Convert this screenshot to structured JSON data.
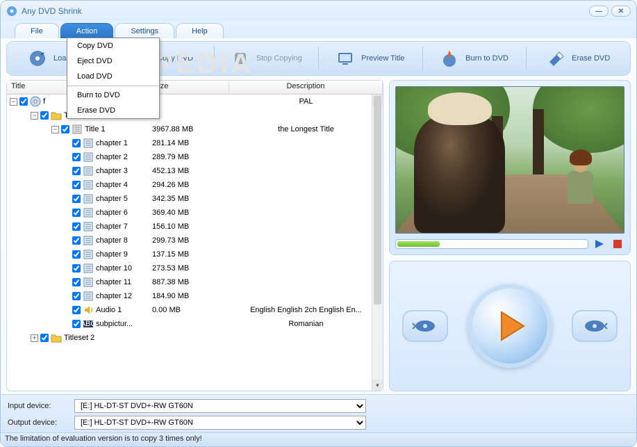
{
  "window": {
    "title": "Any DVD Shrink"
  },
  "menubar": {
    "file": "File",
    "action": "Action",
    "settings": "Settings",
    "help": "Help"
  },
  "dropdown": {
    "copy_dvd": "Copy DVD",
    "eject_dvd": "Eject DVD",
    "load_dvd": "Load DVD",
    "burn_to_dvd": "Burn to DVD",
    "erase_dvd": "Erase DVD"
  },
  "toolbar": {
    "load": "Load DVD",
    "copy": "Copy DVD",
    "stop": "Stop Copying",
    "preview": "Preview Title",
    "burn": "Burn to DVD",
    "erase": "Erase DVD"
  },
  "table": {
    "headers": {
      "title": "Title",
      "size": "Size",
      "desc": "Description"
    },
    "rows": [
      {
        "indent": 0,
        "toggle": "-",
        "chk": true,
        "icon": "disc",
        "label": "f",
        "size": "",
        "desc": "PAL"
      },
      {
        "indent": 1,
        "toggle": "-",
        "chk": true,
        "icon": "folder",
        "label": "Titleset 1",
        "size": "",
        "desc": ""
      },
      {
        "indent": 2,
        "toggle": "-",
        "chk": true,
        "icon": "title",
        "label": "Title 1",
        "size": "3967.88 MB",
        "desc": "the Longest Title"
      },
      {
        "indent": 3,
        "toggle": "",
        "chk": true,
        "icon": "chapter",
        "label": "chapter 1",
        "size": "281.14 MB",
        "desc": ""
      },
      {
        "indent": 3,
        "toggle": "",
        "chk": true,
        "icon": "chapter",
        "label": "chapter 2",
        "size": "289.79 MB",
        "desc": ""
      },
      {
        "indent": 3,
        "toggle": "",
        "chk": true,
        "icon": "chapter",
        "label": "chapter 3",
        "size": "452.13 MB",
        "desc": ""
      },
      {
        "indent": 3,
        "toggle": "",
        "chk": true,
        "icon": "chapter",
        "label": "chapter 4",
        "size": "294.26 MB",
        "desc": ""
      },
      {
        "indent": 3,
        "toggle": "",
        "chk": true,
        "icon": "chapter",
        "label": "chapter 5",
        "size": "342.35 MB",
        "desc": ""
      },
      {
        "indent": 3,
        "toggle": "",
        "chk": true,
        "icon": "chapter",
        "label": "chapter 6",
        "size": "369.40 MB",
        "desc": ""
      },
      {
        "indent": 3,
        "toggle": "",
        "chk": true,
        "icon": "chapter",
        "label": "chapter 7",
        "size": "156.10 MB",
        "desc": ""
      },
      {
        "indent": 3,
        "toggle": "",
        "chk": true,
        "icon": "chapter",
        "label": "chapter 8",
        "size": "299.73 MB",
        "desc": ""
      },
      {
        "indent": 3,
        "toggle": "",
        "chk": true,
        "icon": "chapter",
        "label": "chapter 9",
        "size": "137.15 MB",
        "desc": ""
      },
      {
        "indent": 3,
        "toggle": "",
        "chk": true,
        "icon": "chapter",
        "label": "chapter 10",
        "size": "273.53 MB",
        "desc": ""
      },
      {
        "indent": 3,
        "toggle": "",
        "chk": true,
        "icon": "chapter",
        "label": "chapter 11",
        "size": "887.38 MB",
        "desc": ""
      },
      {
        "indent": 3,
        "toggle": "",
        "chk": true,
        "icon": "chapter",
        "label": "chapter 12",
        "size": "184.90 MB",
        "desc": ""
      },
      {
        "indent": 3,
        "toggle": "",
        "chk": true,
        "icon": "audio",
        "label": "Audio 1",
        "size": "0.00 MB",
        "desc": "English English 2ch English En..."
      },
      {
        "indent": 3,
        "toggle": "",
        "chk": true,
        "icon": "subpic",
        "label": "subpictur...",
        "size": "",
        "desc": "Romanian"
      },
      {
        "indent": 1,
        "toggle": "+",
        "chk": true,
        "icon": "folder",
        "label": "Titleset 2",
        "size": "",
        "desc": ""
      }
    ]
  },
  "devices": {
    "input_label": "Input device:",
    "output_label": "Output device:",
    "input_value": "[E:] HL-DT-ST DVD+-RW GT60N",
    "output_value": "[E:] HL-DT-ST DVD+-RW GT60N"
  },
  "status": "The limitation of evaluation version is to copy 3 times only!",
  "watermark": "SOFTPEDIA"
}
